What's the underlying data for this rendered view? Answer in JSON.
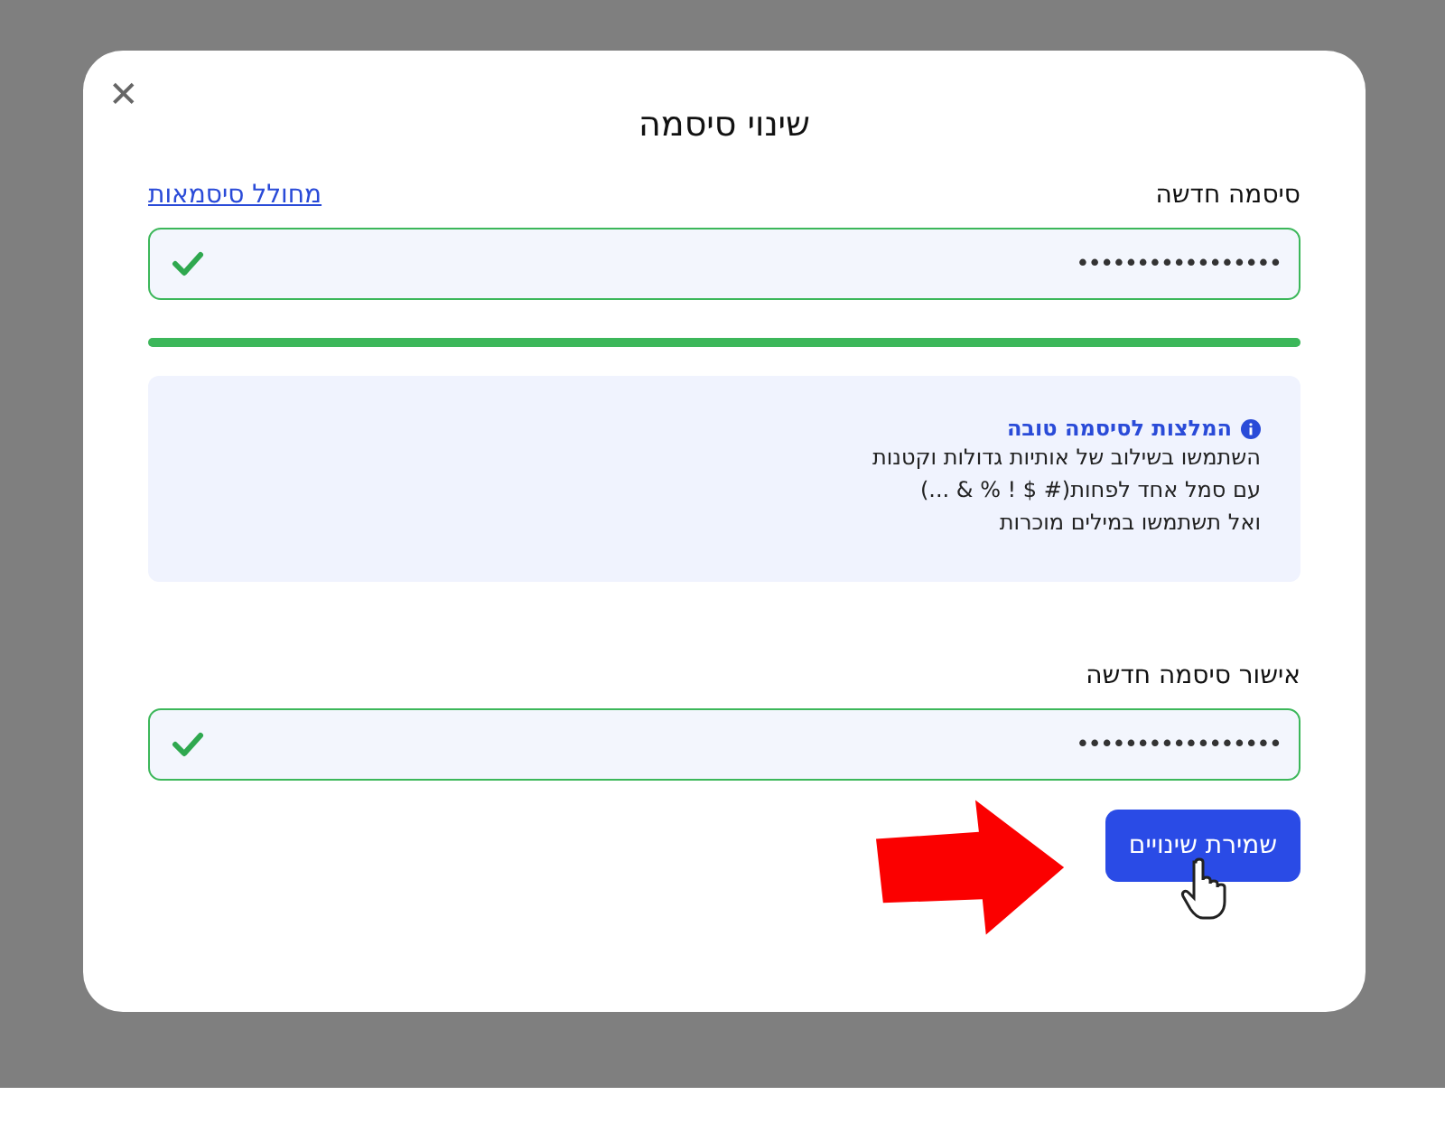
{
  "dialog": {
    "title": "שינוי סיסמה",
    "close": "✕"
  },
  "new_password": {
    "label": "סיסמה חדשה",
    "generator_link": "מחולל סיסמאות",
    "value": "•••••••••••••••••",
    "valid": true
  },
  "strength": {
    "level": 1.0
  },
  "tips": {
    "title": "המלצות לסיסמה טובה",
    "lines": [
      "השתמשו בשילוב של אותיות גדולות וקטנות",
      "עם סמל אחד לפחות(# $ ! % & ...)",
      "ואל תשתמשו במילים מוכרות"
    ]
  },
  "confirm_password": {
    "label": "אישור סיסמה חדשה",
    "value": "•••••••••••••••••",
    "valid": true
  },
  "save_button": "שמירת שינויים"
}
